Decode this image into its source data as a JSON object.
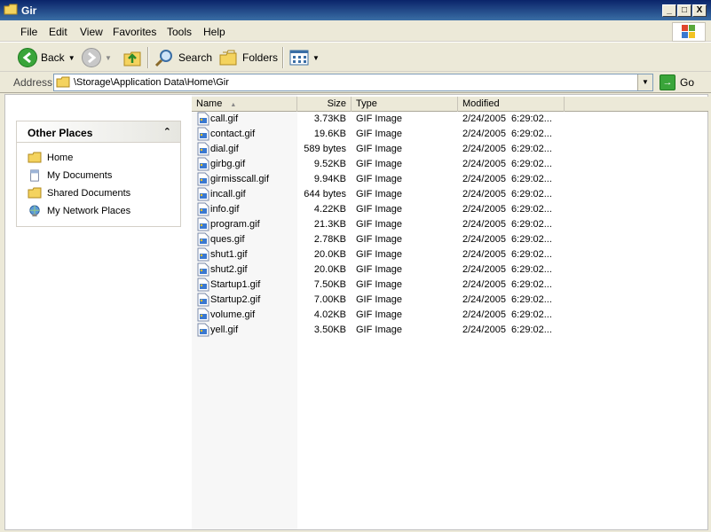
{
  "window": {
    "title": "Gir",
    "controls": {
      "minimize": "_",
      "maximize": "□",
      "close": "X"
    }
  },
  "menu": [
    "File",
    "Edit",
    "View",
    "Favorites",
    "Tools",
    "Help"
  ],
  "toolbar": {
    "back_label": "Back",
    "search_label": "Search",
    "folders_label": "Folders"
  },
  "address": {
    "label": "Address",
    "path": "\\Storage\\Application Data\\Home\\Gir",
    "go_label": "Go"
  },
  "sidebar": {
    "panel_title": "Other Places",
    "collapse_glyph": "⌃",
    "items": [
      {
        "label": "Home",
        "icon": "folder-icon"
      },
      {
        "label": "My Documents",
        "icon": "documents-icon"
      },
      {
        "label": "Shared Documents",
        "icon": "folder-icon"
      },
      {
        "label": "My Network Places",
        "icon": "network-icon"
      }
    ]
  },
  "columns": [
    {
      "label": "Name",
      "sort": "▲"
    },
    {
      "label": "Size"
    },
    {
      "label": "Type"
    },
    {
      "label": "Modified"
    }
  ],
  "files": [
    {
      "name": "call.gif",
      "size": "3.73KB",
      "type": "GIF Image",
      "modified": "2/24/2005  6:29:02..."
    },
    {
      "name": "contact.gif",
      "size": "19.6KB",
      "type": "GIF Image",
      "modified": "2/24/2005  6:29:02..."
    },
    {
      "name": "dial.gif",
      "size": "589 bytes",
      "type": "GIF Image",
      "modified": "2/24/2005  6:29:02..."
    },
    {
      "name": "girbg.gif",
      "size": "9.52KB",
      "type": "GIF Image",
      "modified": "2/24/2005  6:29:02..."
    },
    {
      "name": "girmisscall.gif",
      "size": "9.94KB",
      "type": "GIF Image",
      "modified": "2/24/2005  6:29:02..."
    },
    {
      "name": "incall.gif",
      "size": "644 bytes",
      "type": "GIF Image",
      "modified": "2/24/2005  6:29:02..."
    },
    {
      "name": "info.gif",
      "size": "4.22KB",
      "type": "GIF Image",
      "modified": "2/24/2005  6:29:02..."
    },
    {
      "name": "program.gif",
      "size": "21.3KB",
      "type": "GIF Image",
      "modified": "2/24/2005  6:29:02..."
    },
    {
      "name": "ques.gif",
      "size": "2.78KB",
      "type": "GIF Image",
      "modified": "2/24/2005  6:29:02..."
    },
    {
      "name": "shut1.gif",
      "size": "20.0KB",
      "type": "GIF Image",
      "modified": "2/24/2005  6:29:02..."
    },
    {
      "name": "shut2.gif",
      "size": "20.0KB",
      "type": "GIF Image",
      "modified": "2/24/2005  6:29:02..."
    },
    {
      "name": "Startup1.gif",
      "size": "7.50KB",
      "type": "GIF Image",
      "modified": "2/24/2005  6:29:02..."
    },
    {
      "name": "Startup2.gif",
      "size": "7.00KB",
      "type": "GIF Image",
      "modified": "2/24/2005  6:29:02..."
    },
    {
      "name": "volume.gif",
      "size": "4.02KB",
      "type": "GIF Image",
      "modified": "2/24/2005  6:29:02..."
    },
    {
      "name": "yell.gif",
      "size": "3.50KB",
      "type": "GIF Image",
      "modified": "2/24/2005  6:29:02..."
    }
  ]
}
